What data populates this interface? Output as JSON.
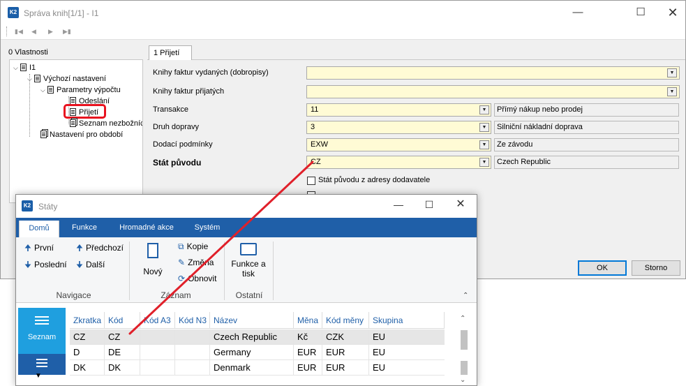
{
  "main_window": {
    "title": "Správa knih[1/1] - I1",
    "minimize_icon": "minimize-icon",
    "maximize_icon": "maximize-icon",
    "close_icon": "close-icon"
  },
  "navigation": {
    "first_icon": "first-record-icon",
    "prev_icon": "prev-record-icon",
    "next_icon": "next-record-icon",
    "last_icon": "last-record-icon"
  },
  "properties_label": "0 Vlastnosti",
  "tree": {
    "root": "I1",
    "vychozi": "Výchozí nastavení",
    "parametry": "Parametry výpočtu",
    "odeslani": "Odeslání",
    "prijeti": "Přijetí",
    "seznam": "Seznam nezbožních",
    "nastaveni_obdobi": "Nastavení pro období"
  },
  "tab": {
    "label": "1 Přijetí"
  },
  "form": {
    "knihy_vydanych": {
      "label": "Knihy faktur vydaných (dobropisy)",
      "value": ""
    },
    "knihy_prijatych": {
      "label": "Knihy faktur přijatých",
      "value": ""
    },
    "transakce": {
      "label": "Transakce",
      "value": "11",
      "description": "Přímý nákup nebo prodej"
    },
    "druh_dopravy": {
      "label": "Druh dopravy",
      "value": "3",
      "description": "Silniční nákladní doprava"
    },
    "dodaci_podminky": {
      "label": "Dodací podmínky",
      "value": "EXW",
      "description": "Ze závodu"
    },
    "stat_puvodu": {
      "label": "Stát původu",
      "value": "CZ",
      "description": "Czech Republic"
    },
    "stat_z_adresy": {
      "label": "Stát původu z adresy dodavatele",
      "checked": false
    }
  },
  "buttons": {
    "ok": "OK",
    "storno": "Storno"
  },
  "staty_window": {
    "title": "Státy",
    "tabs": [
      "Domů",
      "Funkce",
      "Hromadné akce",
      "Systém"
    ],
    "ribbon": {
      "prvni": "První",
      "predchozi": "Předchozí",
      "posledni": "Poslední",
      "dalsi": "Další",
      "novy": "Nový",
      "kopie": "Kopie",
      "zmena": "Změna",
      "obnovit": "Obnovit",
      "funkce_a": "Funkce a",
      "tisk": "tisk",
      "group_navigace": "Navigace",
      "group_zaznam": "Záznam",
      "group_ostatni": "Ostatní"
    },
    "side": {
      "seznam": "Seznam"
    },
    "grid": {
      "columns": [
        "Zkratka",
        "Kód",
        "Kód A3",
        "Kód N3",
        "Název",
        "Měna",
        "Kód měny",
        "Skupina"
      ],
      "rows": [
        [
          "CZ",
          "CZ",
          "",
          "",
          "Czech Republic",
          "Kč",
          "CZK",
          "EU"
        ],
        [
          "D",
          "DE",
          "",
          "",
          "Germany",
          "EUR",
          "EUR",
          "EU"
        ],
        [
          "DK",
          "DK",
          "",
          "",
          "Denmark",
          "EUR",
          "EUR",
          "EU"
        ]
      ]
    }
  },
  "colors": {
    "ribbon_blue": "#1f5fa8",
    "tile_blue": "#1f9fdf",
    "combo_yellow": "#fffbd5",
    "highlight_red": "#e8121f",
    "annotation_red": "#e0202a"
  }
}
